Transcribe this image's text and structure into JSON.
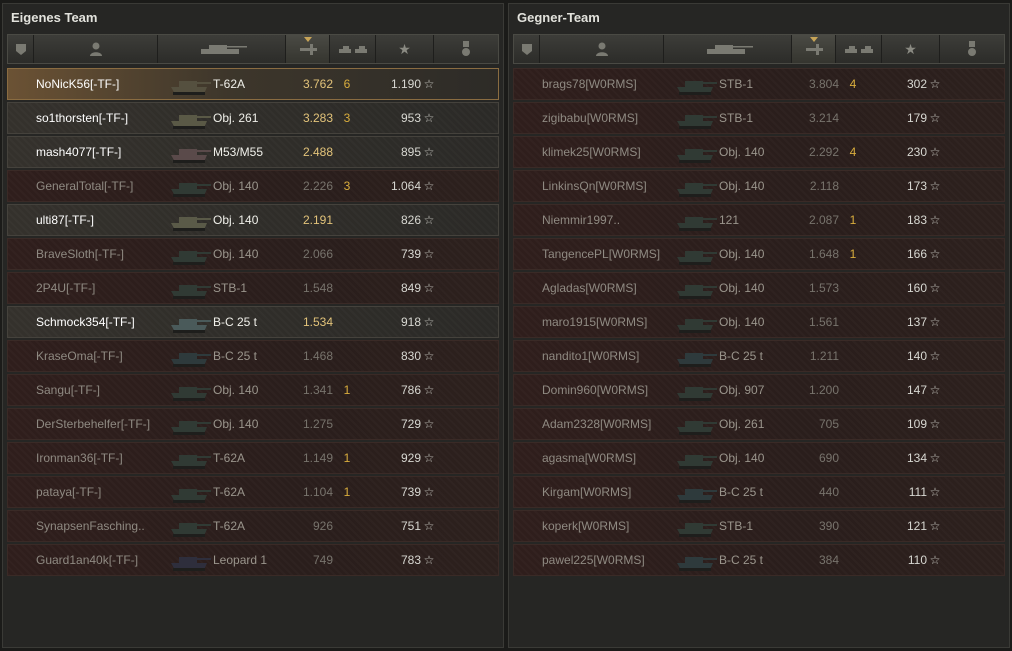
{
  "left": {
    "title": "Eigenes Team",
    "rows": [
      {
        "name": "NoNicK56[-TF-]",
        "tank": "T-62A",
        "rating": "3.762",
        "frags": "6",
        "xp": "1.190",
        "alive": true,
        "hl": true,
        "color": "#55503f"
      },
      {
        "name": "so1thorsten[-TF-]",
        "tank": "Obj. 261",
        "rating": "3.283",
        "frags": "3",
        "xp": "953",
        "alive": true,
        "color": "#5a5946"
      },
      {
        "name": "mash4077[-TF-]",
        "tank": "M53/M55",
        "rating": "2.488",
        "frags": "",
        "xp": "895",
        "alive": true,
        "color": "#5a4a4a"
      },
      {
        "name": "GeneralTotal[-TF-]",
        "tank": "Obj. 140",
        "rating": "2.226",
        "frags": "3",
        "xp": "1.064",
        "alive": false,
        "color": "#303a34"
      },
      {
        "name": "ulti87[-TF-]",
        "tank": "Obj. 140",
        "rating": "2.191",
        "frags": "",
        "xp": "826",
        "alive": true,
        "color": "#5a5a48"
      },
      {
        "name": "BraveSloth[-TF-]",
        "tank": "Obj. 140",
        "rating": "2.066",
        "frags": "",
        "xp": "739",
        "alive": false,
        "color": "#303a34"
      },
      {
        "name": "2P4U[-TF-]",
        "tank": "STB-1",
        "rating": "1.548",
        "frags": "",
        "xp": "849",
        "alive": false,
        "color": "#303a34"
      },
      {
        "name": "Schmock354[-TF-]",
        "tank": "B-C 25 t",
        "rating": "1.534",
        "frags": "",
        "xp": "918",
        "alive": true,
        "color": "#4a5a5a"
      },
      {
        "name": "KraseOma[-TF-]",
        "tank": "B-C 25 t",
        "rating": "1.468",
        "frags": "",
        "xp": "830",
        "alive": false,
        "color": "#2e3a3c"
      },
      {
        "name": "Sangu[-TF-]",
        "tank": "Obj. 140",
        "rating": "1.341",
        "frags": "1",
        "xp": "786",
        "alive": false,
        "color": "#303a34"
      },
      {
        "name": "DerSterbehelfer[-TF-]",
        "tank": "Obj. 140",
        "rating": "1.275",
        "frags": "",
        "xp": "729",
        "alive": false,
        "color": "#303a34"
      },
      {
        "name": "Ironman36[-TF-]",
        "tank": "T-62A",
        "rating": "1.149",
        "frags": "1",
        "xp": "929",
        "alive": false,
        "color": "#303a34"
      },
      {
        "name": "pataya[-TF-]",
        "tank": "T-62A",
        "rating": "1.104",
        "frags": "1",
        "xp": "739",
        "alive": false,
        "color": "#303a34"
      },
      {
        "name": "SynapsenFasching..",
        "tank": "T-62A",
        "rating": "926",
        "frags": "",
        "xp": "751",
        "alive": false,
        "color": "#303a34"
      },
      {
        "name": "Guard1an40k[-TF-]",
        "tank": "Leopard 1",
        "rating": "749",
        "frags": "",
        "xp": "783",
        "alive": false,
        "color": "#2e2e3c"
      }
    ]
  },
  "right": {
    "title": "Gegner-Team",
    "rows": [
      {
        "name": "brags78[W0RMS]",
        "tank": "STB-1",
        "rating": "3.804",
        "frags": "4",
        "xp": "302",
        "alive": false,
        "color": "#303a34"
      },
      {
        "name": "zigibabu[W0RMS]",
        "tank": "STB-1",
        "rating": "3.214",
        "frags": "",
        "xp": "179",
        "alive": false,
        "color": "#303a34"
      },
      {
        "name": "klimek25[W0RMS]",
        "tank": "Obj. 140",
        "rating": "2.292",
        "frags": "4",
        "xp": "230",
        "alive": false,
        "color": "#303a34"
      },
      {
        "name": "LinkinsQn[W0RMS]",
        "tank": "Obj. 140",
        "rating": "2.118",
        "frags": "",
        "xp": "173",
        "alive": false,
        "color": "#303a34"
      },
      {
        "name": "Niemmir1997..",
        "tank": "121",
        "rating": "2.087",
        "frags": "1",
        "xp": "183",
        "alive": false,
        "color": "#303a34"
      },
      {
        "name": "TangencePL[W0RMS]",
        "tank": "Obj. 140",
        "rating": "1.648",
        "frags": "1",
        "xp": "166",
        "alive": false,
        "color": "#303a34"
      },
      {
        "name": "Agladas[W0RMS]",
        "tank": "Obj. 140",
        "rating": "1.573",
        "frags": "",
        "xp": "160",
        "alive": false,
        "color": "#303a34"
      },
      {
        "name": "maro1915[W0RMS]",
        "tank": "Obj. 140",
        "rating": "1.561",
        "frags": "",
        "xp": "137",
        "alive": false,
        "color": "#303a34"
      },
      {
        "name": "nandito1[W0RMS]",
        "tank": "B-C 25 t",
        "rating": "1.211",
        "frags": "",
        "xp": "140",
        "alive": false,
        "color": "#2e3a3c"
      },
      {
        "name": "Domin960[W0RMS]",
        "tank": "Obj. 907",
        "rating": "1.200",
        "frags": "",
        "xp": "147",
        "alive": false,
        "color": "#303a34"
      },
      {
        "name": "Adam2328[W0RMS]",
        "tank": "Obj. 261",
        "rating": "705",
        "frags": "",
        "xp": "109",
        "alive": false,
        "color": "#303a34"
      },
      {
        "name": "agasma[W0RMS]",
        "tank": "Obj. 140",
        "rating": "690",
        "frags": "",
        "xp": "134",
        "alive": false,
        "color": "#303a34"
      },
      {
        "name": "Kirgam[W0RMS]",
        "tank": "B-C 25 t",
        "rating": "440",
        "frags": "",
        "xp": "111",
        "alive": false,
        "color": "#2e3a3c"
      },
      {
        "name": "koperk[W0RMS]",
        "tank": "STB-1",
        "rating": "390",
        "frags": "",
        "xp": "121",
        "alive": false,
        "color": "#303a34"
      },
      {
        "name": "pawel225[W0RMS]",
        "tank": "B-C 25 t",
        "rating": "384",
        "frags": "",
        "xp": "110",
        "alive": false,
        "color": "#2e3a3c"
      }
    ]
  },
  "header_icons": [
    "level-badge-icon",
    "player-icon",
    "tank-icon",
    "damage-icon",
    "frags-icon",
    "xp-star-icon",
    "medal-icon"
  ],
  "star_glyph": "☆"
}
